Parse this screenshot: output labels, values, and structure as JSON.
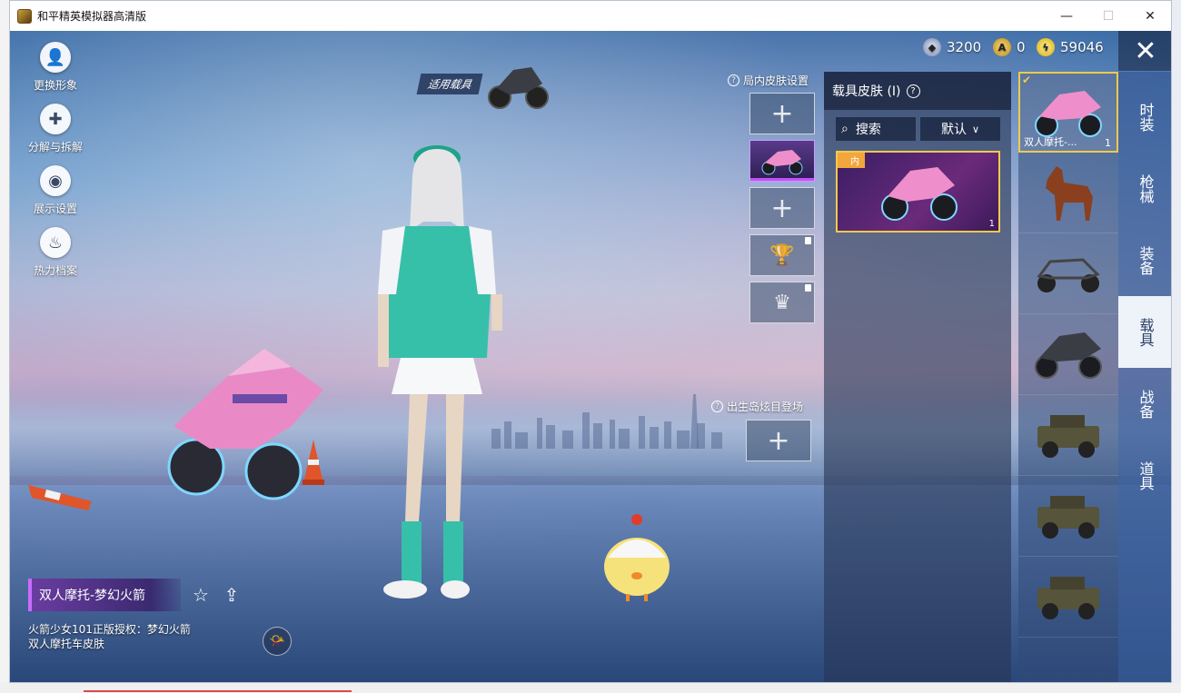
{
  "window": {
    "title": "和平精英模拟器高清版",
    "minimize_glyph": "—",
    "maximize_glyph": "☐",
    "close_glyph": "✕"
  },
  "left_menu": [
    {
      "label": "更换形象",
      "icon": "person-icon"
    },
    {
      "label": "分解与拆解",
      "icon": "puzzle-icon"
    },
    {
      "label": "展示设置",
      "icon": "eye-icon"
    },
    {
      "label": "热力档案",
      "icon": "flame-icon"
    }
  ],
  "currency": [
    {
      "icon": "silver-coin-icon",
      "value": "3200"
    },
    {
      "icon": "gold-token-icon",
      "value": "0"
    },
    {
      "icon": "lightning-coin-icon",
      "value": "59046"
    }
  ],
  "applied": {
    "label": "适用载具"
  },
  "in_match_skin": {
    "title": "局内皮肤设置"
  },
  "birth_island": {
    "title": "出生岛炫目登场"
  },
  "skin_panel": {
    "title": "载具皮肤 (I)",
    "search_label": "搜索",
    "sort_label": "默认",
    "card_badge": "内",
    "card_count": "1"
  },
  "vehicle_list": [
    {
      "name": "双人摩托-...",
      "count": "1",
      "selected": true,
      "icon": "pink-motorcycle-icon"
    },
    {
      "name": "",
      "count": "",
      "icon": "horse-icon"
    },
    {
      "name": "",
      "count": "",
      "icon": "buggy-icon"
    },
    {
      "name": "",
      "count": "",
      "icon": "motorcycle-icon"
    },
    {
      "name": "",
      "count": "",
      "icon": "jeep-icon"
    },
    {
      "name": "",
      "count": "",
      "icon": "jeep-icon"
    },
    {
      "name": "",
      "count": "",
      "icon": "jeep-icon"
    }
  ],
  "categories": [
    {
      "label": "时装"
    },
    {
      "label": "枪械"
    },
    {
      "label": "装备"
    },
    {
      "label": "载具",
      "active": true
    },
    {
      "label": "战备"
    },
    {
      "label": "道具"
    }
  ],
  "item": {
    "name": "双人摩托-梦幻火箭",
    "description": "火箭少女101正版授权：梦幻火箭双人摩托车皮肤"
  }
}
